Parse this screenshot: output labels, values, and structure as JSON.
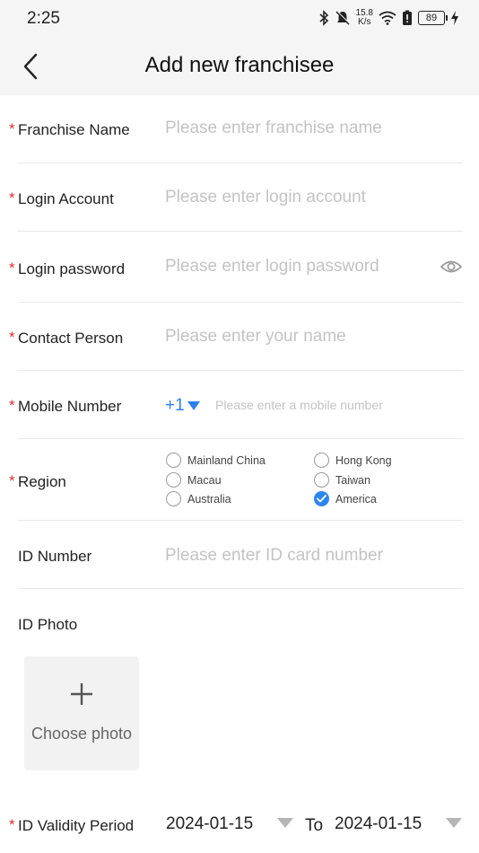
{
  "status_bar": {
    "time": "2:25",
    "net_speed_value": "15.8",
    "net_speed_unit": "K/s",
    "battery": "89"
  },
  "header": {
    "title": "Add new franchisee",
    "back_icon": "chevron-left-icon"
  },
  "form": {
    "required_mark": "*",
    "franchise_name": {
      "label": "Franchise Name",
      "placeholder": "Please enter franchise name",
      "value": ""
    },
    "login_account": {
      "label": "Login Account",
      "placeholder": "Please enter login account",
      "value": ""
    },
    "login_password": {
      "label": "Login password",
      "placeholder": "Please enter login password",
      "value": "",
      "toggle_icon": "eye-icon"
    },
    "contact_person": {
      "label": "Contact Person",
      "placeholder": "Please enter your name",
      "value": ""
    },
    "mobile_number": {
      "label": "Mobile Number",
      "country_code": "+1",
      "placeholder": "Please enter a mobile number",
      "value": ""
    },
    "region": {
      "label": "Region",
      "options": [
        "Mainland China",
        "Hong Kong",
        "Macau",
        "Taiwan",
        "Australia",
        "America"
      ],
      "selected": "America"
    },
    "id_number": {
      "label": "ID Number",
      "placeholder": "Please enter ID card number",
      "value": ""
    },
    "id_photo": {
      "label": "ID Photo",
      "choose_label": "Choose photo",
      "icon": "plus-icon"
    },
    "id_validity": {
      "label": "ID Validity Period",
      "start": "2024-01-15",
      "to_label": "To",
      "end": "2024-01-15"
    }
  },
  "colors": {
    "accent": "#2d7ff0",
    "required": "#e02d2d",
    "placeholder": "#c3c3c3",
    "header_bg": "#f5f5f5"
  }
}
